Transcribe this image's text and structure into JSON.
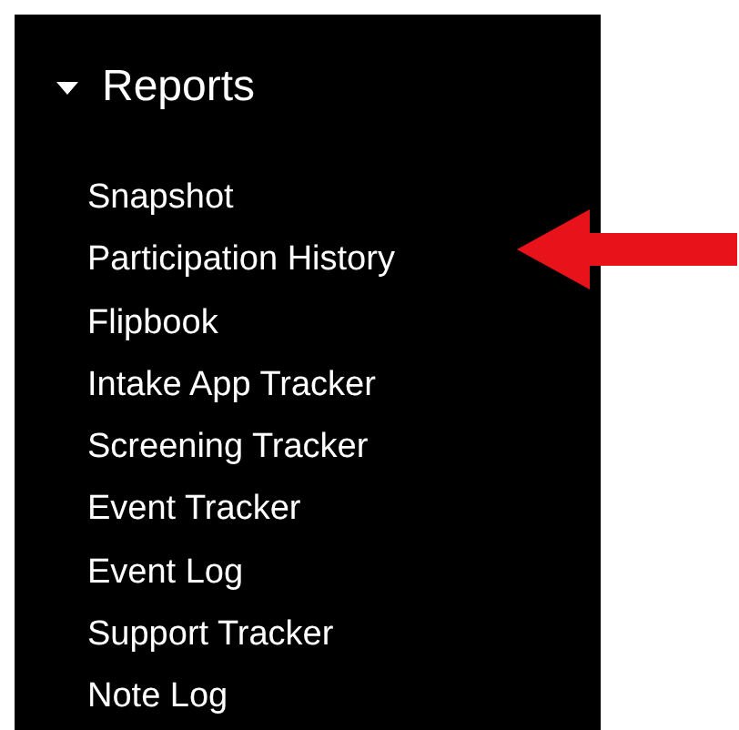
{
  "section": {
    "title": "Reports",
    "expanded": true
  },
  "items": [
    {
      "label": "Snapshot"
    },
    {
      "label": "Participation History"
    },
    {
      "label": "Flipbook"
    },
    {
      "label": "Intake App Tracker"
    },
    {
      "label": "Screening Tracker"
    },
    {
      "label": "Event Tracker"
    },
    {
      "label": "Event Log"
    },
    {
      "label": "Support Tracker"
    },
    {
      "label": "Note Log"
    }
  ]
}
